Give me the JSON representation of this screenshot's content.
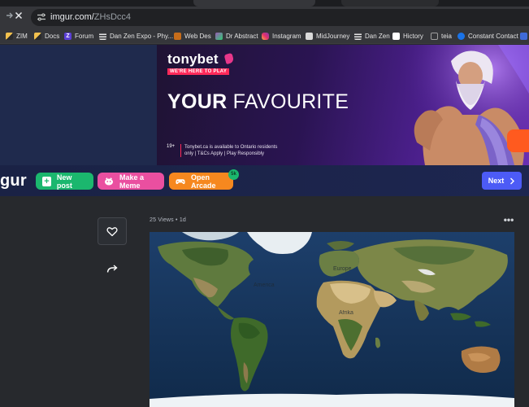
{
  "browser": {
    "url_host": "imgur.com/",
    "url_path": "ZHsDcc4"
  },
  "bookmarks": [
    {
      "label": "ZIM",
      "icon": "zim-icon",
      "color": "#d6a31a"
    },
    {
      "label": "Docs",
      "icon": "docs-icon",
      "color": "#d6a31a"
    },
    {
      "label": "Forum",
      "icon": "forum-icon",
      "color": "#7a5cff"
    },
    {
      "label": "Dan Zen Expo - Phy...",
      "icon": "page-icon",
      "color": "#e6e6e6"
    },
    {
      "label": "Web Des",
      "icon": "webdes-icon",
      "color": "#cc7722"
    },
    {
      "label": "Dr Abstract",
      "icon": "drabstract-icon",
      "color": "#8e44ad"
    },
    {
      "label": "Instagram",
      "icon": "instagram-icon",
      "color": "#e1306c"
    },
    {
      "label": "MidJourney",
      "icon": "midjourney-icon",
      "color": "#d9d9d9"
    },
    {
      "label": "Dan Zen",
      "icon": "page-icon",
      "color": "#e6e6e6"
    },
    {
      "label": "Hictory",
      "icon": "page-icon",
      "color": "#ffffff"
    },
    {
      "label": "teia",
      "icon": "teia-icon",
      "color": "#9e9e9e"
    },
    {
      "label": "Constant Contact",
      "icon": "constant-contact-icon",
      "color": "#1a73e8"
    },
    {
      "label": "",
      "icon": "extra-bookmark-icon",
      "color": "#3f6ad8"
    }
  ],
  "ad": {
    "brand": "tonybet",
    "slogan": "WE'RE HERE TO PLAY",
    "headline_bold": "YOUR",
    "headline_rest": " FAVOURITE",
    "age": "19+",
    "fine_print_1": "Tonybet.ca is available to Ontario residents",
    "fine_print_2": "only  |  T&Cs Apply  |  Play Responsibly"
  },
  "imgur": {
    "logo": "gur",
    "new_post": "New post",
    "make_meme": "Make a Meme",
    "open_arcade": "Open Arcade",
    "arcade_badge": "5k",
    "next": "Next"
  },
  "post": {
    "views": "25 Views",
    "age": "1d",
    "more": "•••",
    "map_labels": {
      "north_america": "America",
      "europe": "Europe",
      "africa": "Afrika"
    }
  },
  "colors": {
    "new_post": "#1bb76e",
    "make_meme": "#ea4fa0",
    "open_arcade": "#f6881f",
    "next": "#4c5bf6",
    "header_bg": "#1d2650",
    "page_bg": "#27292d"
  }
}
